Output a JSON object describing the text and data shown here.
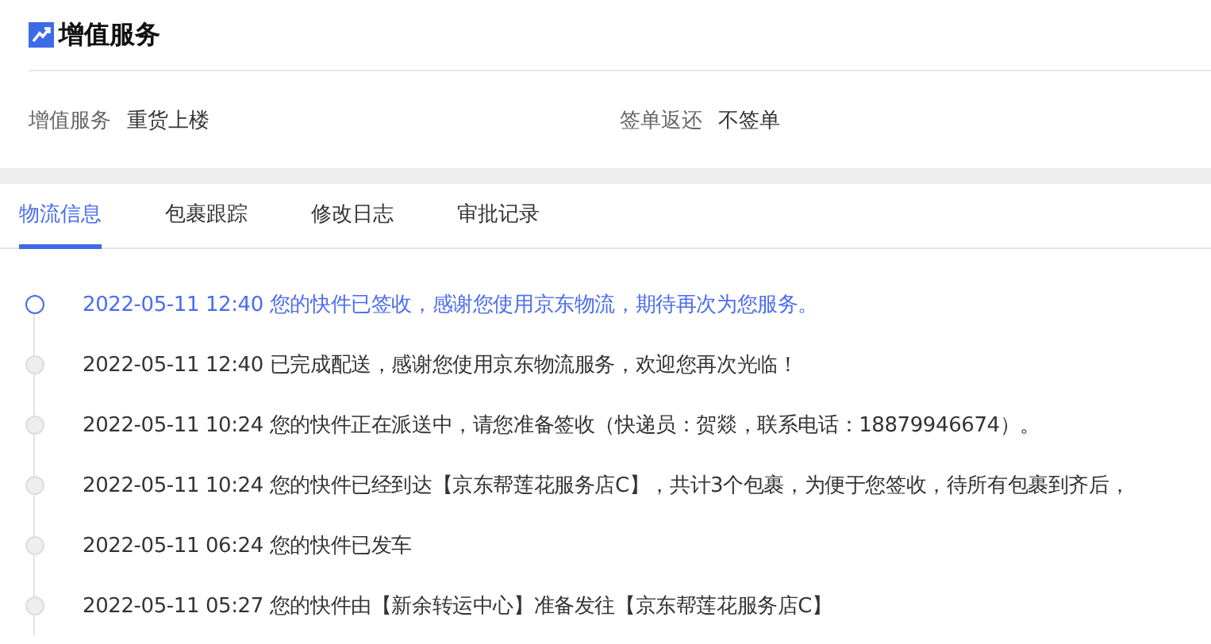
{
  "section": {
    "title": "增值服务"
  },
  "info": [
    {
      "label": "增值服务",
      "value": "重货上楼"
    },
    {
      "label": "签单返还",
      "value": "不签单"
    }
  ],
  "tabs": [
    {
      "label": "物流信息",
      "selected": true
    },
    {
      "label": "包裹跟踪",
      "selected": false
    },
    {
      "label": "修改日志",
      "selected": false
    },
    {
      "label": "审批记录",
      "selected": false
    }
  ],
  "timeline": [
    {
      "text": "2022-05-11 12:40 您的快件已签收，感谢您使用京东物流，期待再次为您服务。",
      "current": true
    },
    {
      "text": "2022-05-11 12:40 已完成配送，感谢您使用京东物流服务，欢迎您再次光临！",
      "current": false
    },
    {
      "text": "2022-05-11 10:24 您的快件正在派送中，请您准备签收（快递员：贺燚，联系电话：18879946674）。",
      "current": false
    },
    {
      "text": "2022-05-11 10:24 您的快件已经到达【京东帮莲花服务店C】，共计3个包裹，为便于您签收，待所有包裹到齐后，",
      "current": false
    },
    {
      "text": "2022-05-11 06:24 您的快件已发车",
      "current": false
    },
    {
      "text": "2022-05-11 05:27 您的快件由【新余转运中心】准备发往【京东帮莲花服务店C】",
      "current": false
    }
  ]
}
